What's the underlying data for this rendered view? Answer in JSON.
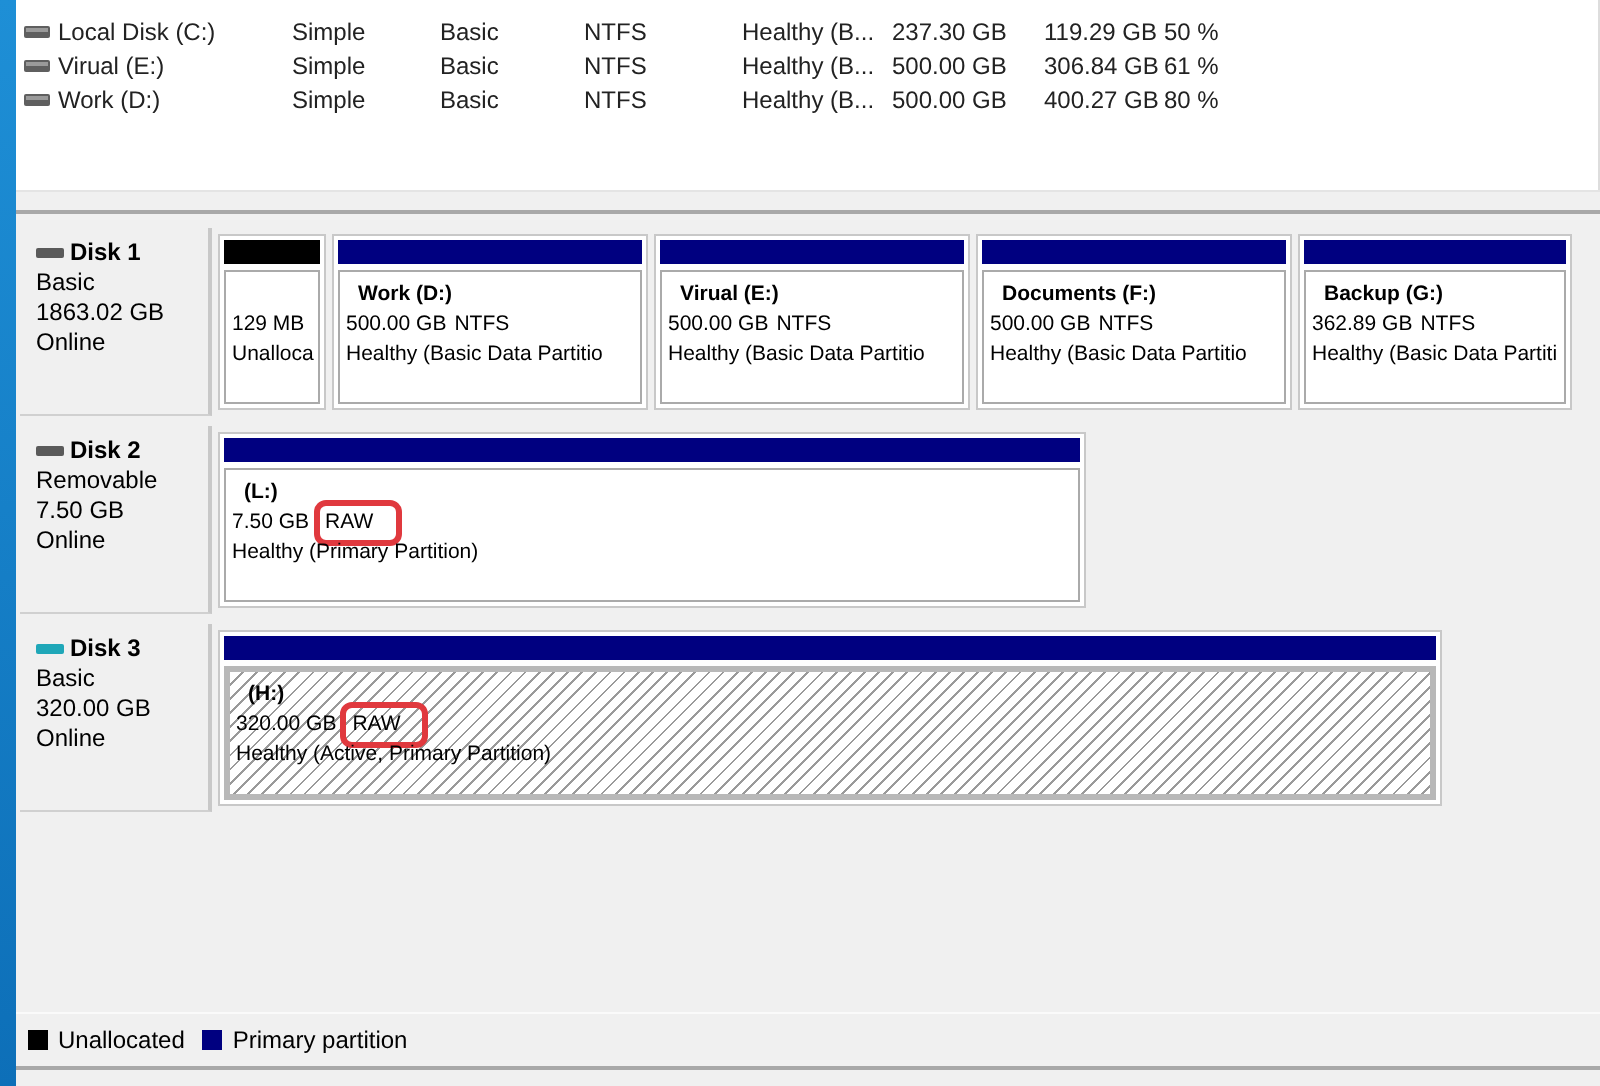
{
  "volumes": [
    {
      "name": "Local Disk (C:)",
      "layout": "Simple",
      "type": "Basic",
      "file_system": "NTFS",
      "status": "Healthy (B...",
      "capacity": "237.30 GB",
      "free_space": "119.29 GB",
      "percent_free": "50 %"
    },
    {
      "name": "Virual (E:)",
      "layout": "Simple",
      "type": "Basic",
      "file_system": "NTFS",
      "status": "Healthy (B...",
      "capacity": "500.00 GB",
      "free_space": "306.84 GB",
      "percent_free": "61 %"
    },
    {
      "name": "Work (D:)",
      "layout": "Simple",
      "type": "Basic",
      "file_system": "NTFS",
      "status": "Healthy (B...",
      "capacity": "500.00 GB",
      "free_space": "400.27 GB",
      "percent_free": "80 %"
    }
  ],
  "disks": [
    {
      "name": "Disk 1",
      "type": "Basic",
      "size": "1863.02 GB",
      "status": "Online",
      "color": "#5a5a5a",
      "partitions": [
        {
          "kind": "unallocated",
          "size": "129 MB",
          "status": "Unalloca",
          "selected": false
        },
        {
          "kind": "primary",
          "title": "Work  (D:)",
          "size": "500.00 GB",
          "file_system": "NTFS",
          "status": "Healthy (Basic Data Partitio",
          "selected": false
        },
        {
          "kind": "primary",
          "title": "Virual  (E:)",
          "size": "500.00 GB",
          "file_system": "NTFS",
          "status": "Healthy (Basic Data Partitio",
          "selected": false
        },
        {
          "kind": "primary",
          "title": "Documents  (F:)",
          "size": "500.00 GB",
          "file_system": "NTFS",
          "status": "Healthy (Basic Data Partitio",
          "selected": false
        },
        {
          "kind": "primary",
          "title": "Backup  (G:)",
          "size": "362.89 GB",
          "file_system": "NTFS",
          "status": "Healthy (Basic Data Partiti",
          "selected": false
        }
      ]
    },
    {
      "name": "Disk 2",
      "type": "Removable",
      "size": "7.50 GB",
      "status": "Online",
      "color": "#5a5a5a",
      "partitions": [
        {
          "kind": "primary",
          "title": "(L:)",
          "size": "7.50 GB",
          "file_system": "RAW",
          "status": "Healthy (Primary Partition)",
          "selected": false,
          "highlighted": true
        }
      ]
    },
    {
      "name": "Disk 3",
      "type": "Basic",
      "size": "320.00 GB",
      "status": "Online",
      "color": "#1fa7b8",
      "partitions": [
        {
          "kind": "primary",
          "title": "(H:)",
          "size": "320.00 GB",
          "file_system": "RAW",
          "status": "Healthy (Active, Primary Partition)",
          "selected": true,
          "highlighted": true
        }
      ]
    }
  ],
  "legend": [
    {
      "label": "Unallocated",
      "color": "#000000"
    },
    {
      "label": "Primary partition",
      "color": "#000080"
    }
  ]
}
